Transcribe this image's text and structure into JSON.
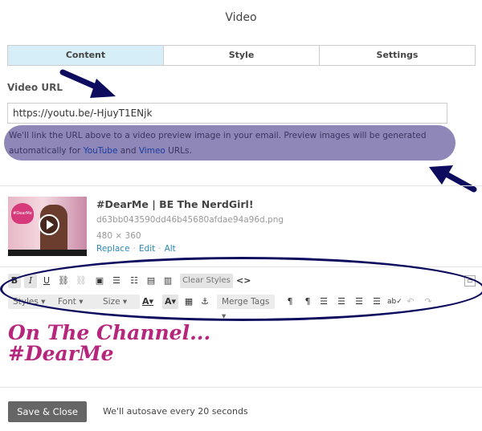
{
  "header": {
    "title": "Video"
  },
  "tabs": [
    {
      "label": "Content",
      "active": true
    },
    {
      "label": "Style",
      "active": false
    },
    {
      "label": "Settings",
      "active": false
    }
  ],
  "video_url": {
    "label": "Video URL",
    "value": "https://youtu.be/-HjuyT1ENjk",
    "hint_before": "We'll link the URL above to a video preview image in your email. Preview images will be generated automatically for ",
    "hint_link1": "YouTube",
    "hint_middle": " and ",
    "hint_link2": "Vimeo",
    "hint_after": " URLs."
  },
  "video": {
    "title": "#DearMe | BE The NerdGirl!",
    "filename": "d63bb043590dd46b45680afdae94a96d.png",
    "dimensions": "480 × 360",
    "actions": [
      "Replace",
      "Edit",
      "Alt"
    ],
    "thumb_caption": "#DearMe"
  },
  "toolbar": {
    "row1": [
      "B",
      "I",
      "U",
      "link",
      "unlink",
      "image",
      "ordered-list",
      "unordered-list",
      "paste-text",
      "paste-word"
    ],
    "clear_styles": "Clear Styles",
    "source": "<>",
    "row2_dropdowns": [
      "Styles",
      "Font",
      "Size"
    ],
    "merge_tags": "Merge Tags"
  },
  "editor": {
    "line1": "On The Channel...",
    "line2": "#DearMe"
  },
  "footer": {
    "save_label": "Save & Close",
    "autosave": "We'll autosave every 20 seconds"
  },
  "colors": {
    "tab_active": "#d6eef7",
    "hint_highlight": "#8e87b8",
    "annotation_navy": "#0c0b5e",
    "editor_text": "#b5267c",
    "link": "#2a8ab8",
    "save_button": "#666666"
  }
}
